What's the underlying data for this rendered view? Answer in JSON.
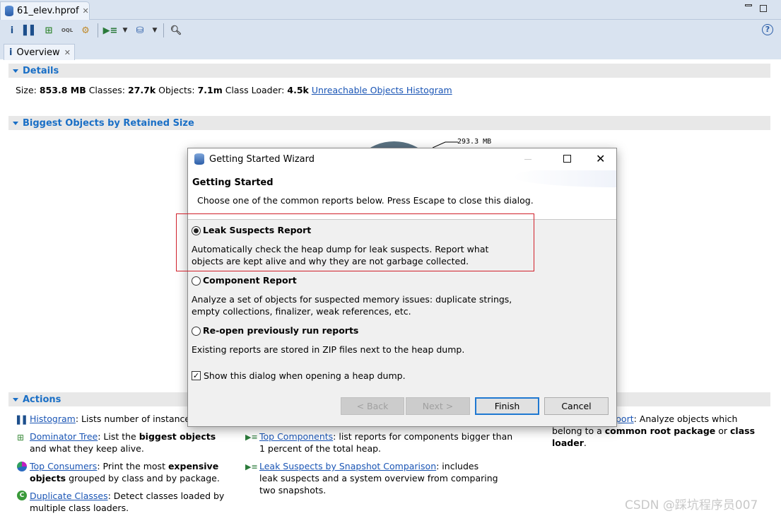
{
  "editor_tab": {
    "label": "61_elev.hprof",
    "icon": "heap-dump-database-icon"
  },
  "toolbar": {
    "icons": [
      "info-icon",
      "histogram-icon",
      "dominator-tree-icon",
      "oql-icon",
      "gear-icon",
      "run-report-icon",
      "dropdown-icon",
      "heap-dump-icon",
      "dropdown-icon",
      "search-icon",
      "help-icon"
    ]
  },
  "overview_tab": {
    "label": "Overview"
  },
  "details": {
    "title": "Details",
    "size_label": "Size:",
    "size": "853.8 MB",
    "classes_label": "Classes:",
    "classes": "27.7k",
    "objects_label": "Objects:",
    "objects": "7.1m",
    "loader_label": "Class Loader:",
    "loader": "4.5k",
    "link": "Unreachable Objects Histogram"
  },
  "biggest": {
    "title": "Biggest Objects by Retained Size",
    "pie_label": "293.3 MB"
  },
  "actions": {
    "title": "Actions",
    "histogram": {
      "link": "Histogram",
      "text": ": Lists number of instances p"
    },
    "dominator": {
      "link": "Dominator Tree",
      "t1": ": List the ",
      "b1": "biggest objects",
      "t2": " and what they keep alive."
    },
    "consumers": {
      "link": "Top Consumers",
      "t1": ": Print the most ",
      "b1": "expensive objects",
      "t2": " grouped by class and by package."
    },
    "duplicate": {
      "link": "Duplicate Classes",
      "t1": ": Detect classes loaded by multiple class loaders."
    },
    "components": {
      "link": "Top Components",
      "t1": ": list reports for components bigger than 1 percent of the total heap."
    },
    "comparison": {
      "link": "Leak Suspects by Snapshot Comparison",
      "t1": ": includes leak suspects and a system overview from comparing two snapshots."
    },
    "component_report": {
      "link": "port",
      "t1": ": Analyze objects which belong to a ",
      "b1": "common root package",
      "t2": " or ",
      "b2": "class loader",
      "t3": "."
    }
  },
  "dialog": {
    "title": "Getting Started Wizard",
    "heading": "Getting Started",
    "subtitle": "Choose one of the common reports below. Press Escape to close this dialog.",
    "options": [
      {
        "label": "Leak Suspects Report",
        "desc": "Automatically check the heap dump for leak suspects. Report what objects are kept alive and why they are not garbage collected.",
        "selected": true
      },
      {
        "label": "Component Report",
        "desc": "Analyze a set of objects for suspected memory issues: duplicate strings, empty collections, finalizer, weak references, etc.",
        "selected": false
      },
      {
        "label": "Re-open previously run reports",
        "desc": "Existing reports are stored in ZIP files next to the heap dump.",
        "selected": false
      }
    ],
    "show_dialog": {
      "label": "Show this dialog when opening a heap dump.",
      "checked": true
    },
    "buttons": {
      "back": "< Back",
      "next": "Next >",
      "finish": "Finish",
      "cancel": "Cancel"
    }
  },
  "watermark": "CSDN @踩坑程序员007",
  "colors": {
    "link": "#1a55b5",
    "section": "#1a6fc6",
    "highlight": "#d0202a"
  }
}
